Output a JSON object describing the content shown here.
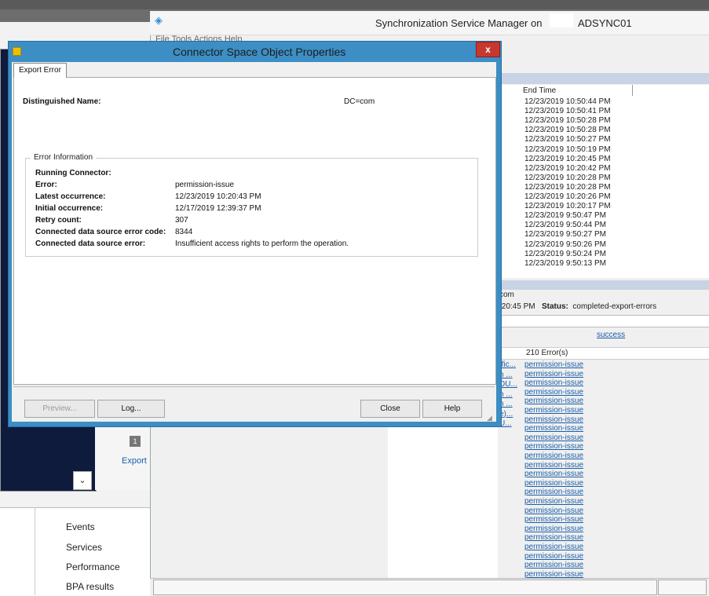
{
  "background_left": {
    "nav_items": [
      "Events",
      "Services",
      "Performance",
      "BPA results"
    ],
    "export_label": "Export",
    "export_icon_text": "1",
    "scroll_glyph": "⌄"
  },
  "sync_manager": {
    "title": "Synchronization Service Manager on",
    "host": "ADSYNC01",
    "menu_text": "File   Tools   Actions   Help",
    "end_time_header": "End Time",
    "end_times": [
      "12/23/2019 10:50:44 PM",
      "12/23/2019 10:50:41 PM",
      "12/23/2019 10:50:28 PM",
      "12/23/2019 10:50:28 PM",
      "12/23/2019 10:50:27 PM",
      "12/23/2019 10:50:19 PM",
      "12/23/2019 10:20:45 PM",
      "12/23/2019 10:20:42 PM",
      "12/23/2019 10:20:28 PM",
      "12/23/2019 10:20:28 PM",
      "12/23/2019 10:20:26 PM",
      "12/23/2019 10:20:17 PM",
      "12/23/2019 9:50:47 PM",
      "12/23/2019 9:50:44 PM",
      "12/23/2019 9:50:27 PM",
      "12/23/2019 9:50:26 PM",
      "12/23/2019 9:50:24 PM",
      "12/23/2019 9:50:13 PM"
    ],
    "info_partial": "com",
    "time_partial": ":20:45 PM",
    "status_label": "Status:",
    "status_value": "completed-export-errors",
    "success_link": "success",
    "errors_header": "210 Error(s)",
    "err_col_partials": [
      "ffic...",
      "n ...",
      "DU...",
      "n ...",
      "n ...",
      "e)...",
      "U..."
    ],
    "error_items": [
      "permission-issue",
      "permission-issue",
      "permission-issue",
      "permission-issue",
      "permission-issue",
      "permission-issue",
      "permission-issue",
      "permission-issue",
      "permission-issue",
      "permission-issue",
      "permission-issue",
      "permission-issue",
      "permission-issue",
      "permission-issue",
      "permission-issue",
      "permission-issue",
      "permission-issue",
      "permission-issue",
      "permission-issue",
      "permission-issue",
      "permission-issue",
      "permission-issue",
      "permission-issue",
      "permission-issue"
    ]
  },
  "dialog": {
    "title": "Connector Space Object Properties",
    "close_glyph": "x",
    "tab_label": "Export Error",
    "dn_label": "Distinguished Name:",
    "dn_value": "DC=com",
    "group_title": "Error Information",
    "rows": [
      {
        "label": "Running Connector:",
        "value": ""
      },
      {
        "label": "Error:",
        "value": "permission-issue"
      },
      {
        "label": "Latest occurrence:",
        "value": "12/23/2019 10:20:43 PM"
      },
      {
        "label": "Initial occurrence:",
        "value": "12/17/2019 12:39:37 PM"
      },
      {
        "label": "Retry count:",
        "value": "307"
      },
      {
        "label": "Connected data source error code:",
        "value": "8344"
      },
      {
        "label": "Connected data source error:",
        "value": "Insufficient access rights to perform the operation."
      }
    ],
    "buttons": {
      "preview": "Preview...",
      "log": "Log...",
      "close": "Close",
      "help": "Help"
    }
  }
}
